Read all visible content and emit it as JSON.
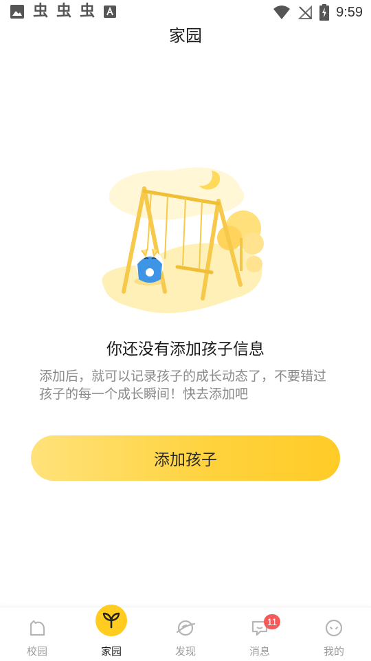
{
  "status_bar": {
    "time": "9:59",
    "bug_glyph": "虫",
    "left_icons": [
      "image-icon",
      "bug-icon",
      "bug-icon",
      "bug-icon",
      "font-icon"
    ],
    "right_icons": [
      "wifi-icon",
      "no-signal-icon",
      "battery-charging-icon"
    ]
  },
  "header": {
    "title": "家园"
  },
  "empty_state": {
    "illustration": "swing-illustration",
    "title": "你还没有添加孩子信息",
    "description": "添加后，就可以记录孩子的成长动态了，不要错过孩子的每一个成长瞬间！快去添加吧"
  },
  "add_button": {
    "label": "添加孩子"
  },
  "tab_bar": {
    "tabs": [
      {
        "label": "校园",
        "icon": "campus-icon"
      },
      {
        "label": "家园",
        "icon": "sprout-icon",
        "active": true
      },
      {
        "label": "发现",
        "icon": "planet-icon"
      },
      {
        "label": "消息",
        "icon": "chat-icon",
        "badge": "11"
      },
      {
        "label": "我的",
        "icon": "face-icon"
      }
    ]
  },
  "colors": {
    "accent": "#ffcc1f",
    "badge": "#f55a5a",
    "muted_text": "#8a8a8a"
  }
}
